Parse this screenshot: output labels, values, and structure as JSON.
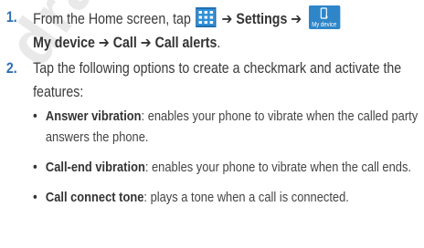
{
  "watermark": "draft",
  "steps": [
    {
      "number": "1.",
      "intro": "From the Home screen, tap",
      "arrow": "➔",
      "settings": "Settings",
      "device_icon_label": "My device",
      "my_device": "My device",
      "call": "Call",
      "call_alerts": "Call alerts",
      "end": "."
    },
    {
      "number": "2.",
      "text": "Tap the following options to create a checkmark and activate the features:",
      "bullet": "•",
      "options": [
        {
          "name": "Answer vibration",
          "desc": ": enables your phone to vibrate when the called party answers the phone."
        },
        {
          "name": "Call-end vibration",
          "desc": ": enables your phone to vibrate when the call ends."
        },
        {
          "name": "Call connect tone",
          "desc": ": plays a tone when a call is connected."
        }
      ]
    }
  ],
  "colors": {
    "step_number": "#2f6fb4",
    "icon_blue": "#2e86c9",
    "watermark": "#e9e9e9"
  },
  "icons": [
    "apps-grid-icon",
    "my-device-icon"
  ]
}
